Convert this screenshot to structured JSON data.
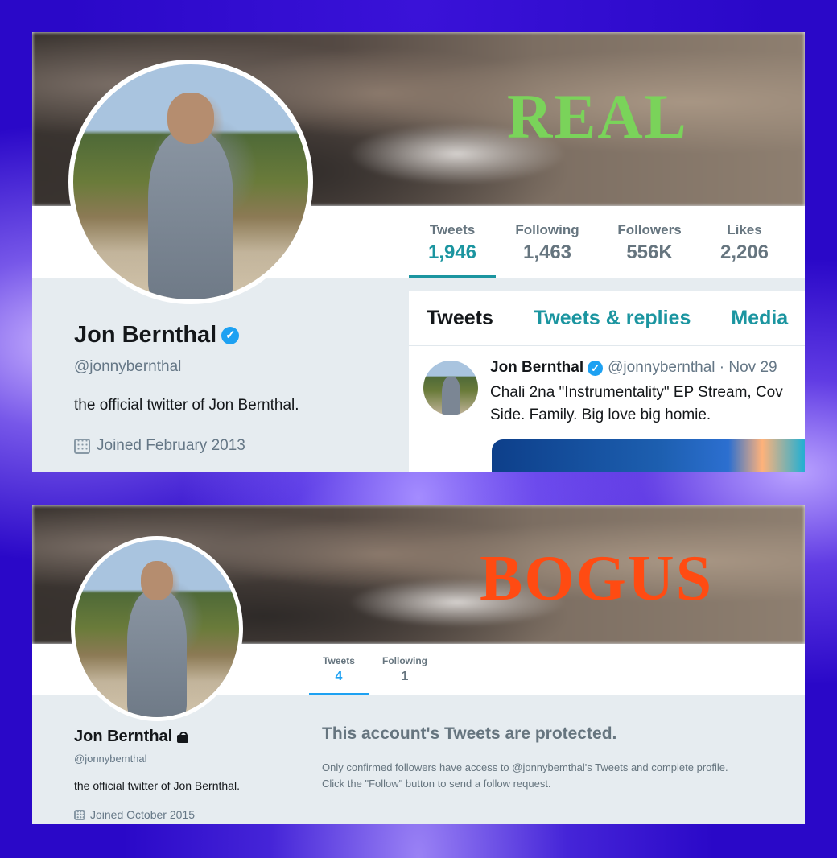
{
  "real": {
    "label": "REAL",
    "stats": [
      {
        "label": "Tweets",
        "value": "1,946"
      },
      {
        "label": "Following",
        "value": "1,463"
      },
      {
        "label": "Followers",
        "value": "556K"
      },
      {
        "label": "Likes",
        "value": "2,206"
      }
    ],
    "profile": {
      "name": "Jon Bernthal",
      "verified_mark": "✓",
      "handle": "@jonnybernthal",
      "bio": "the official twitter of Jon Bernthal.",
      "joined": "Joined February 2013"
    },
    "tabs": [
      "Tweets",
      "Tweets & replies",
      "Media"
    ],
    "tweet": {
      "name": "Jon Bernthal",
      "handle": "@jonnybernthal · Nov 29",
      "line1": "Chali 2na \"Instrumentality\" EP Stream, Cov",
      "line2": "Side. Family.  Big love big homie."
    }
  },
  "bogus": {
    "label": "BOGUS",
    "stats": [
      {
        "label": "Tweets",
        "value": "4"
      },
      {
        "label": "Following",
        "value": "1"
      }
    ],
    "profile": {
      "name": "Jon Bernthal",
      "handle": "@jonnybemthal",
      "bio": "the official twitter of Jon Bernthal.",
      "joined": "Joined October 2015"
    },
    "protected": {
      "title": "This account's Tweets are protected.",
      "line1": "Only confirmed followers have access to @jonnybemthal's Tweets and complete profile.",
      "line2": "Click the \"Follow\" button to send a follow request."
    }
  },
  "colors": {
    "real_label": "#7ad35a",
    "bogus_label": "#ff4b12",
    "twitter_teal": "#1b95a0",
    "twitter_blue": "#1da1f2"
  }
}
